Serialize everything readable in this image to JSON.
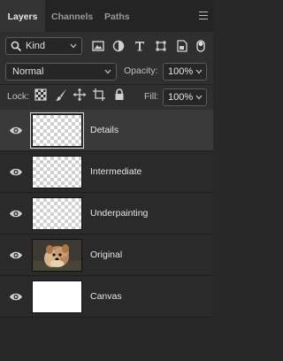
{
  "tabs": [
    {
      "label": "Layers",
      "active": true
    },
    {
      "label": "Channels",
      "active": false
    },
    {
      "label": "Paths",
      "active": false
    }
  ],
  "filter": {
    "kind_label": "Kind",
    "icons": [
      "image-filter-icon",
      "adjustment-filter-icon",
      "type-filter-icon",
      "shape-filter-icon",
      "smart-object-filter-icon",
      "filter-toggle-icon"
    ]
  },
  "blend_mode": "Normal",
  "opacity": {
    "label": "Opacity:",
    "value": "100%"
  },
  "lock": {
    "label": "Lock:",
    "icons": [
      "lock-transparent-pixels-icon",
      "lock-image-pixels-icon",
      "lock-position-icon",
      "lock-artboard-icon",
      "lock-all-icon"
    ]
  },
  "fill": {
    "label": "Fill:",
    "value": "100%"
  },
  "layers": [
    {
      "name": "Details",
      "thumb": "checker",
      "selected": true,
      "visible": true
    },
    {
      "name": "Intermediate",
      "thumb": "checker",
      "selected": false,
      "visible": true
    },
    {
      "name": "Underpainting",
      "thumb": "checker",
      "selected": false,
      "visible": true
    },
    {
      "name": "Original",
      "thumb": "photo",
      "selected": false,
      "visible": true
    },
    {
      "name": "Canvas",
      "thumb": "white",
      "selected": false,
      "visible": true
    }
  ],
  "colors": {
    "panel_bg": "#282828",
    "selected_row": "#3a3a3a",
    "text": "#e4e4e4"
  }
}
